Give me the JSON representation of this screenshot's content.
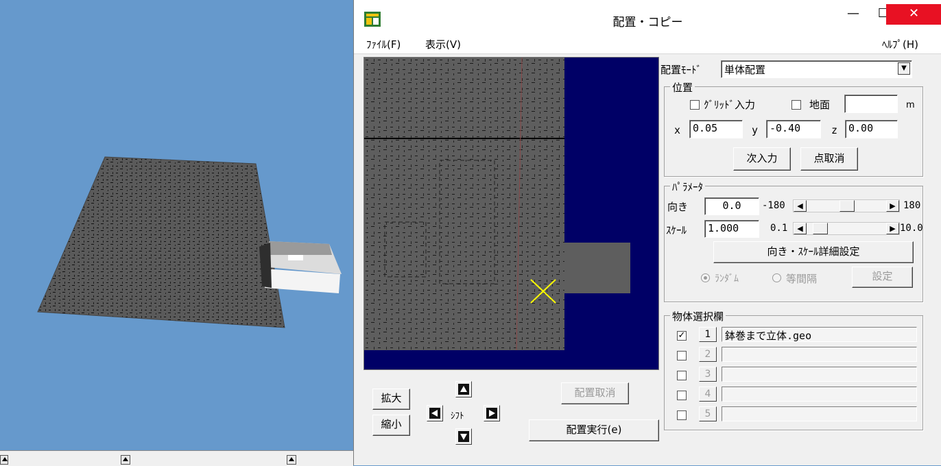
{
  "dialog": {
    "title": "配置・コピー",
    "min_glyph": "—",
    "max_glyph": "☐",
    "close_glyph": "✕"
  },
  "menu": {
    "file": "ﾌｧｲﾙ(F)",
    "view": "表示(V)",
    "help": "ﾍﾙﾌﾟ(H)"
  },
  "mode": {
    "label": "配置ﾓｰﾄﾞ",
    "value": "単体配置"
  },
  "position": {
    "group_title": "位置",
    "grid_input_label": "ｸﾞﾘｯﾄﾞ入力",
    "grid_input_checked": false,
    "ground_label": "地面",
    "ground_checked": false,
    "ground_value": "",
    "unit": "m",
    "x_label": "x",
    "x_value": "0.05",
    "y_label": "y",
    "y_value": "-0.40",
    "z_label": "z",
    "z_value": "0.00",
    "next_input_button": "次入力",
    "cancel_point_button": "点取消"
  },
  "parameters": {
    "group_title": "ﾊﾟﾗﾒｰﾀ",
    "direction_label": "向き",
    "direction_value": "0.0",
    "direction_min": "-180",
    "direction_max": "180",
    "direction_fraction": 0.5,
    "scale_label": "ｽｹｰﾙ",
    "scale_value": "1.000",
    "scale_min": "0.1",
    "scale_max": "10.0",
    "scale_fraction": 0.09,
    "detail_button": "向き・ｽｹｰﾙ詳細設定",
    "random_label": "ﾗﾝﾀﾞﾑ",
    "random_selected": true,
    "equal_label": "等間隔",
    "equal_selected": false,
    "set_button": "設定"
  },
  "objects": {
    "group_title": "物体選択欄",
    "items": [
      {
        "num": "1",
        "name": "鉢巻まで立体.geo",
        "checked": true
      },
      {
        "num": "2",
        "name": "",
        "checked": false
      },
      {
        "num": "3",
        "name": "",
        "checked": false
      },
      {
        "num": "4",
        "name": "",
        "checked": false
      },
      {
        "num": "5",
        "name": "",
        "checked": false
      }
    ]
  },
  "navigation": {
    "zoom_in": "拡大",
    "zoom_out": "縮小",
    "shift_label": "ｼﾌﾄ"
  },
  "actions": {
    "cancel_placement": "配置取消",
    "execute_placement": "配置実行(e)"
  },
  "colors": {
    "viewport_bg": "#6699cc",
    "map_bg": "#000066",
    "ground_gray": "#5a5a5a",
    "cursor_yellow": "#ffff00",
    "close_red": "#e81123"
  }
}
